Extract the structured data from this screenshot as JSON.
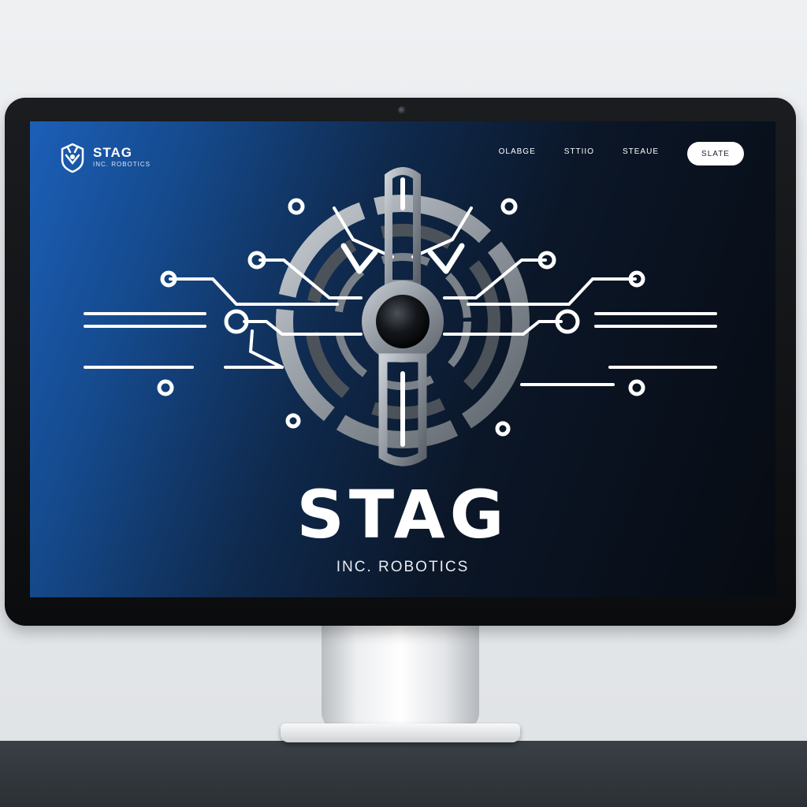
{
  "header": {
    "brand_name": "STAG",
    "brand_sub": "INC. ROBOTICS",
    "nav": [
      "OLABGE",
      "STTIIO",
      "STEAUE"
    ],
    "cta_label": "SLATE"
  },
  "hero": {
    "title": "STAG",
    "subtitle": "INC. ROBOTICS"
  },
  "colors": {
    "screen_gradient_start": "#1c5fb8",
    "screen_gradient_end": "#070b12",
    "accent": "#ffffff",
    "metal": "#9aa0a8"
  },
  "icons": [
    "stag-logo-icon",
    "circuit-emblem-icon"
  ]
}
